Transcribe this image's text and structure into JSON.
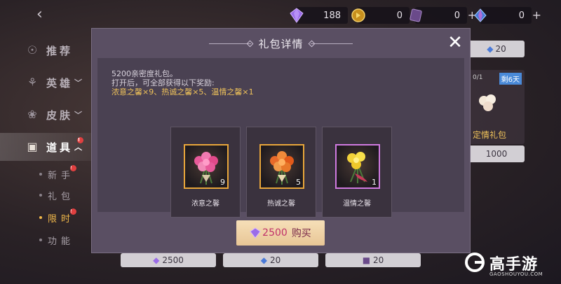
{
  "topbar": {
    "currencies": [
      {
        "icon": "purple-diamond-icon",
        "value": "188",
        "has_plus": false
      },
      {
        "icon": "gold-coin-icon",
        "value": "0",
        "has_plus": true
      },
      {
        "icon": "purple-ticket-icon",
        "value": "0",
        "has_plus": true
      },
      {
        "icon": "blue-crystal-icon",
        "value": "0",
        "has_plus": true
      }
    ]
  },
  "sidebar": {
    "items": [
      {
        "label": "推荐",
        "icon": "compass-icon",
        "chevron": ""
      },
      {
        "label": "英雄",
        "icon": "helmet-icon",
        "chevron": "﹀"
      },
      {
        "label": "皮肤",
        "icon": "flower-icon",
        "chevron": "﹀"
      },
      {
        "label": "道具",
        "icon": "gift-box-icon",
        "chevron": "︿",
        "badge": "!"
      }
    ],
    "sub_items": [
      {
        "label": "新手",
        "badge": "!"
      },
      {
        "label": "礼包",
        "badge": ""
      },
      {
        "label": "限时",
        "badge": "!"
      },
      {
        "label": "功能",
        "badge": ""
      }
    ]
  },
  "background": {
    "card_top_price": "20",
    "card_mid_tag": "剩6天",
    "card_mid_progress": "0/1",
    "card_mid_title": "定情礼包",
    "card_mid_price": "1000",
    "bottom_prices": [
      "2500",
      "20",
      "20"
    ]
  },
  "modal": {
    "title": "礼包详情",
    "desc_line1": "5200亲密度礼包。",
    "desc_line2": "打开后，可全部获得以下奖励:",
    "desc_line3": "浓意之馨×9、热诚之馨×5、温情之馨×1",
    "rewards": [
      {
        "name": "浓意之馨",
        "count": "9",
        "rarity": "orange",
        "flower": "pink"
      },
      {
        "name": "热诚之馨",
        "count": "5",
        "rarity": "orange",
        "flower": "orange"
      },
      {
        "name": "温情之馨",
        "count": "1",
        "rarity": "purple",
        "flower": "yellow"
      }
    ],
    "buy": {
      "price": "2500",
      "label": "购买",
      "icon": "purple-diamond-icon"
    },
    "close_label": "✕"
  },
  "watermark": {
    "brand": "高手游",
    "site": "GAOSHOUYOU.COM"
  }
}
